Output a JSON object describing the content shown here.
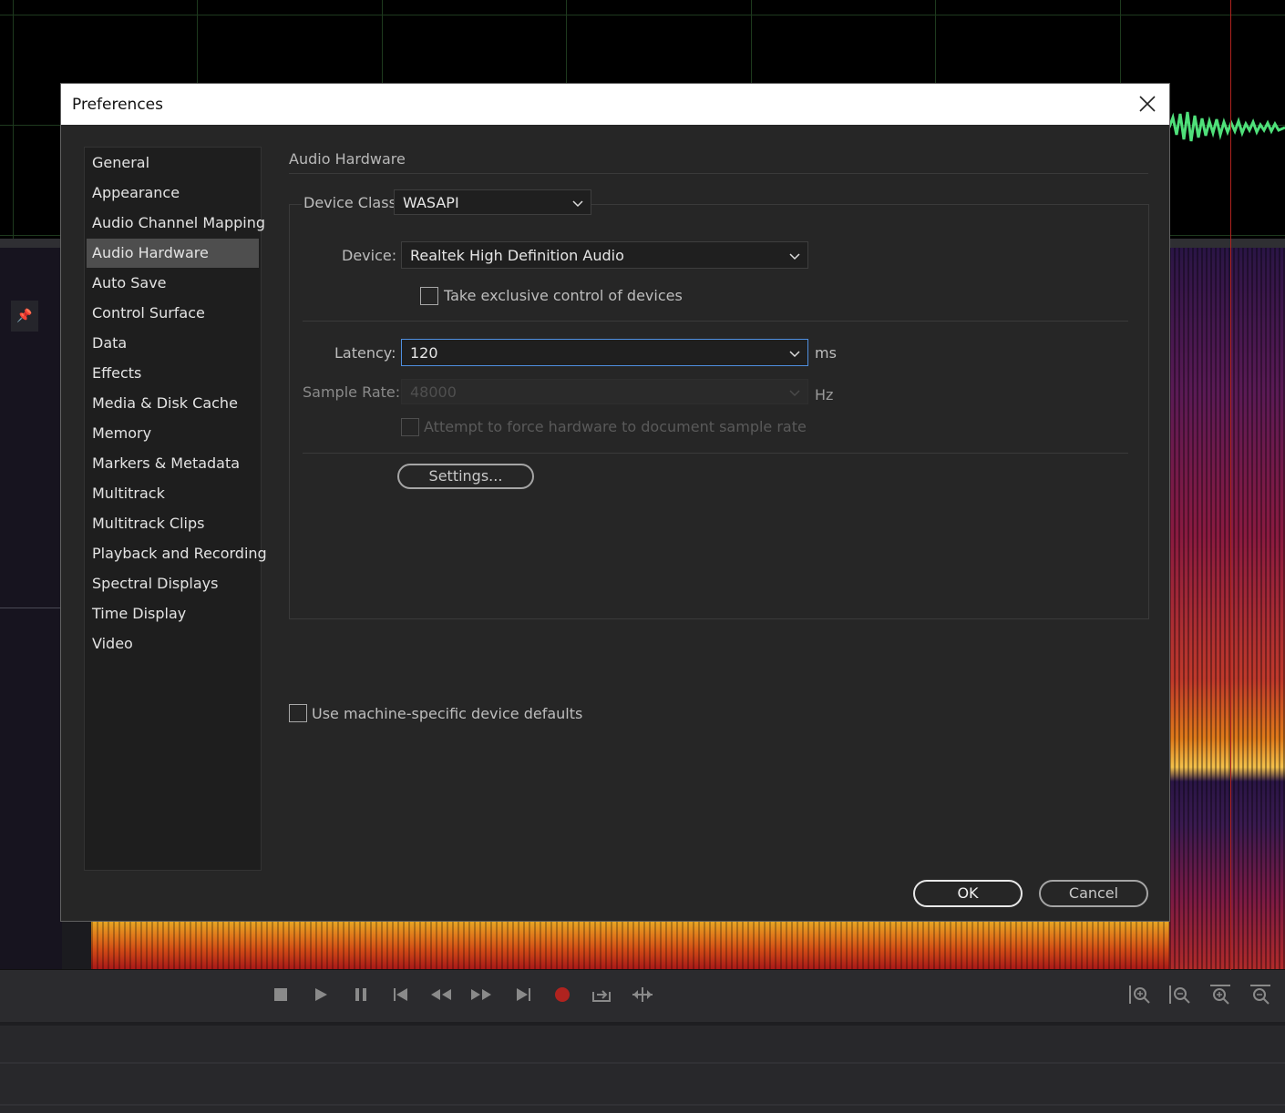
{
  "dialog": {
    "title": "Preferences",
    "nav_items": [
      {
        "label": "General"
      },
      {
        "label": "Appearance"
      },
      {
        "label": "Audio Channel Mapping"
      },
      {
        "label": "Audio Hardware",
        "selected": true
      },
      {
        "label": "Auto Save"
      },
      {
        "label": "Control Surface"
      },
      {
        "label": "Data"
      },
      {
        "label": "Effects"
      },
      {
        "label": "Media & Disk Cache"
      },
      {
        "label": "Memory"
      },
      {
        "label": "Markers & Metadata"
      },
      {
        "label": "Multitrack"
      },
      {
        "label": "Multitrack Clips"
      },
      {
        "label": "Playback and Recording"
      },
      {
        "label": "Spectral Displays"
      },
      {
        "label": "Time Display"
      },
      {
        "label": "Video"
      }
    ],
    "panel": {
      "title": "Audio Hardware",
      "device_class_label": "Device Class:",
      "device_class_value": "WASAPI",
      "device_label": "Device:",
      "device_value": "Realtek High Definition Audio",
      "exclusive_label": "Take exclusive control of devices",
      "exclusive_checked": false,
      "latency_label": "Latency:",
      "latency_value": "120",
      "latency_unit": "ms",
      "sample_rate_label": "Sample Rate:",
      "sample_rate_value": "48000",
      "sample_rate_unit": "Hz",
      "force_rate_label": "Attempt to force hardware to document sample rate",
      "settings_button": "Settings...",
      "machine_defaults_label": "Use machine-specific device defaults",
      "machine_defaults_checked": false
    },
    "ok_button": "OK",
    "cancel_button": "Cancel"
  },
  "colors": {
    "dialog_bg": "#262626",
    "selected_nav_bg": "#4e4e4e",
    "focus_border": "#4f8fe0",
    "playhead": "#b0231f",
    "record_button": "#b0231f"
  },
  "transport_icons": [
    "stop-icon",
    "play-icon",
    "pause-icon",
    "skip-to-start-icon",
    "rewind-icon",
    "fast-forward-icon",
    "skip-to-end-icon",
    "record-icon",
    "loop-playback-icon",
    "skip-selection-icon"
  ],
  "zoom_icons": [
    "zoom-in-amplitude-icon",
    "zoom-out-amplitude-icon",
    "zoom-in-time-icon",
    "zoom-out-time-icon"
  ]
}
